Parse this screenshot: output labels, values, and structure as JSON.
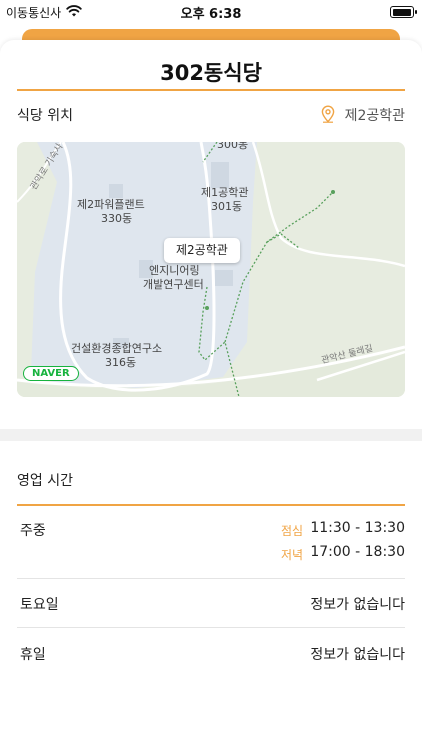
{
  "status_bar": {
    "carrier": "이동통신사",
    "time": "오후 6:38",
    "battery_level": 1.0
  },
  "header": {
    "title": "302동식당"
  },
  "location": {
    "label": "식당 위치",
    "value": "제2공학관",
    "icon": "location-pin-icon"
  },
  "map": {
    "labels": {
      "bldg_300": "300동",
      "bldg_330_name": "제2파워플랜트",
      "bldg_330_num": "330동",
      "bldg_301_name": "제1공학관",
      "bldg_301_num": "301동",
      "engineering_center_1": "엔지니어링",
      "engineering_center_2": "개발연구센터",
      "bldg_316_name": "건설환경종합연구소",
      "bldg_316_num": "316동",
      "road_left": "관악로 기숙사",
      "road_bottom": "관악산 둘레길"
    },
    "marker_label": "제2공학관",
    "provider": "NAVER",
    "colors": {
      "campus": "#dfe6ee",
      "park": "#e7ece0",
      "road": "#ffffff",
      "trail": "#58a05c",
      "provider": "#17b33e"
    }
  },
  "hours": {
    "heading": "영업 시간",
    "accent_color": "#f0a444",
    "weekday": {
      "label": "주중",
      "lunch_label": "점심",
      "lunch_time": "11:30 - 13:30",
      "dinner_label": "저녁",
      "dinner_time": "17:00 - 18:30"
    },
    "saturday": {
      "label": "토요일",
      "value": "정보가 없습니다"
    },
    "holiday": {
      "label": "휴일",
      "value": "정보가 없습니다"
    }
  }
}
